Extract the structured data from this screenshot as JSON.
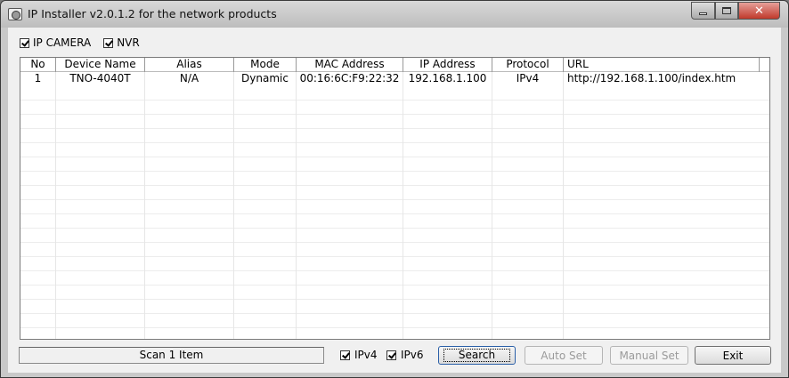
{
  "window": {
    "title": "IP Installer v2.0.1.2 for the network products"
  },
  "filters": {
    "ip_camera": {
      "label": "IP CAMERA",
      "checked": true
    },
    "nvr": {
      "label": "NVR",
      "checked": true
    }
  },
  "table": {
    "columns": [
      "No",
      "Device Name",
      "Alias",
      "Mode",
      "MAC Address",
      "IP Address",
      "Protocol",
      "URL"
    ],
    "rows": [
      {
        "no": "1",
        "device_name": "TNO-4040T",
        "alias": "N/A",
        "mode": "Dynamic",
        "mac": "00:16:6C:F9:22:32",
        "ip": "192.168.1.100",
        "protocol": "IPv4",
        "url": "http://192.168.1.100/index.htm"
      }
    ]
  },
  "footer": {
    "status": "Scan 1 Item",
    "ipv4": {
      "label": "IPv4",
      "checked": true
    },
    "ipv6": {
      "label": "IPv6",
      "checked": true
    },
    "search_label": "Search",
    "auto_set_label": "Auto Set",
    "manual_set_label": "Manual Set",
    "exit_label": "Exit"
  }
}
